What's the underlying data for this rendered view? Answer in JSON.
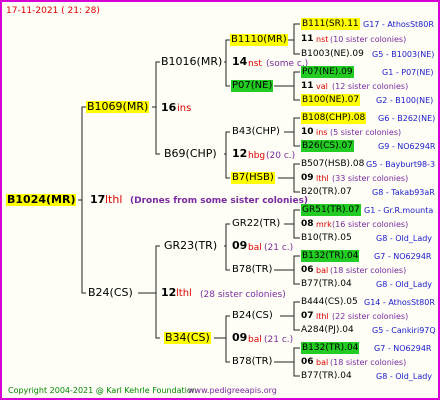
{
  "header": {
    "date": "17-11-2021 ( 21: 28)"
  },
  "footer": {
    "copyright": "Copyright 2004-2021 @ Karl Kehrle Foundation",
    "site": "www.pedigreeapis.org"
  },
  "root": {
    "name": "B1024(MR)",
    "num": "17",
    "kind": "lthl",
    "note": "(Drones from some sister colonies)"
  },
  "gen1": [
    {
      "name": "B1069(MR)",
      "num": "16",
      "kind": "ins"
    },
    {
      "name": "B24(CS)",
      "num": "12",
      "kind": "lthl",
      "note": "(28 sister colonies)"
    }
  ],
  "gen2": [
    {
      "name": "B1016(MR)",
      "num": "14",
      "kind": "nst",
      "note": "(some c.)"
    },
    {
      "name": "B69(CHP)",
      "num": "12",
      "kind": "hbg",
      "note": "(20 c.)"
    },
    {
      "name": "GR23(TR)",
      "num": "09",
      "kind": "bal",
      "note": "(21 c.)"
    },
    {
      "name": "B34(CS)",
      "num": "09",
      "kind": "bal",
      "note": "(21 c.)"
    }
  ],
  "gen3": [
    {
      "name": "B1110(MR)"
    },
    {
      "name": "P07(NE)"
    },
    {
      "name": "B43(CHP)"
    },
    {
      "name": "B7(HSB)"
    },
    {
      "name": "GR22(TR)"
    },
    {
      "name": "B78(TR)"
    },
    {
      "name": "B24(CS)"
    },
    {
      "name": "B78(TR)"
    }
  ],
  "gen4": [
    {
      "top": "B111(SR).11",
      "right": "G17 - AthosSt80R",
      "num": "11",
      "kind": "nst",
      "note": "(10 sister colonies)",
      "bottom": "B1003(NE).09",
      "bright": "G5 - B1003(NE)"
    },
    {
      "top": "P07(NE).09",
      "right": "G1 - P07(NE)",
      "num": "11",
      "kind": "val",
      "note": "(12 sister colonies)",
      "bottom": "B100(NE).07",
      "bright": "G2 - B100(NE)"
    },
    {
      "top": "B108(CHP).08",
      "right": "G6 - B262(NE)",
      "num": "10",
      "kind": "ins",
      "note": "(5 sister colonies)",
      "bottom": "B26(CS).07",
      "bright": "G9 - NO6294R"
    },
    {
      "top": "B507(HSB).08",
      "right": "G5 - Bayburt98-3",
      "num": "09",
      "kind": "lthl",
      "note": "(33 sister colonies)",
      "bottom": "B20(TR).07",
      "bright": "G8 - Takab93aR"
    },
    {
      "top": "GR51(TR).07",
      "right": "G1 - Gr.R.mounta",
      "num": "08",
      "kind": "mrk",
      "note": "(16 sister colonies)",
      "bottom": "B10(TR).05",
      "bright": "G8 - Old_Lady"
    },
    {
      "top": "B132(TR).04",
      "right": "G7 - NO6294R",
      "num": "06",
      "kind": "bal",
      "note": "(18 sister colonies)",
      "bottom": "B77(TR).04",
      "bright": "G8 - Old_Lady"
    },
    {
      "top": "B444(CS).05",
      "right": "G14 - AthosSt80R",
      "num": "07",
      "kind": "lthl",
      "note": "(22 sister colonies)",
      "bottom": "A284(PJ).04",
      "bright": "G5 - Cankiri97Q"
    },
    {
      "top": "B132(TR).04",
      "right": "G7 - NO6294R",
      "num": "06",
      "kind": "bal",
      "note": "(18 sister colonies)",
      "bottom": "B77(TR).04",
      "bright": "G8 - Old_Lady"
    }
  ]
}
